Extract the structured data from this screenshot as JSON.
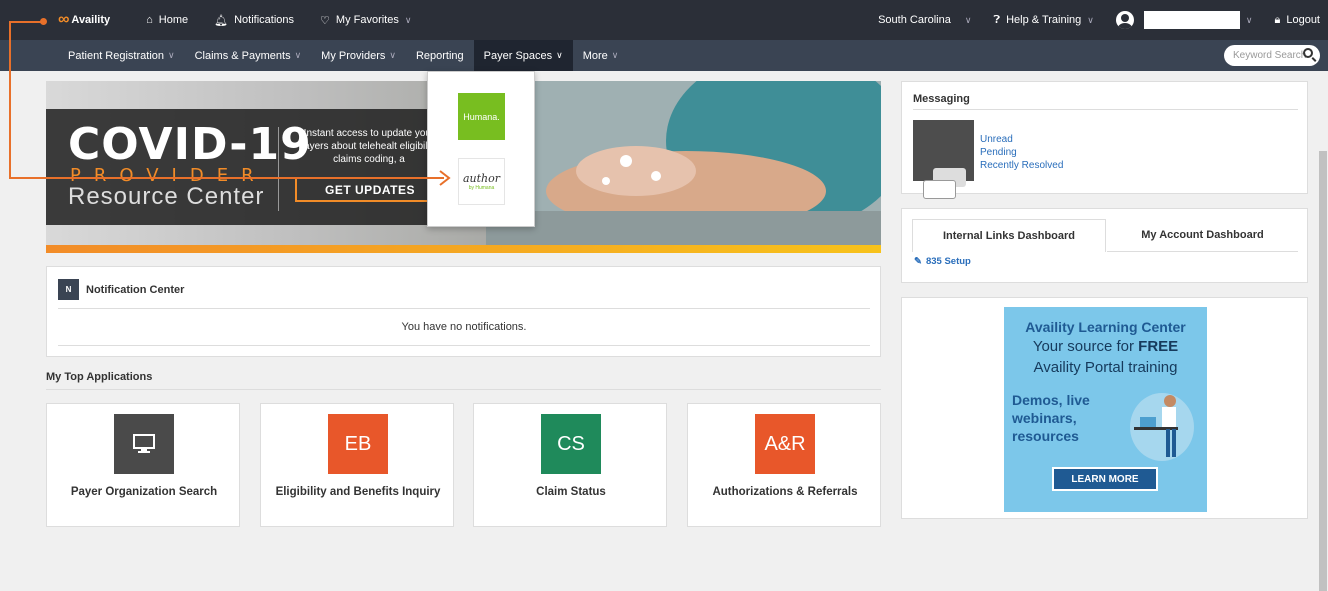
{
  "topbar": {
    "brand": "Availity",
    "home": "Home",
    "notifications": "Notifications",
    "favorites": "My Favorites",
    "region": "South Carolina",
    "help": "Help & Training",
    "logout": "Logout"
  },
  "subnav": {
    "items": [
      "Patient Registration",
      "Claims & Payments",
      "My Providers",
      "Reporting",
      "Payer Spaces",
      "More"
    ],
    "search_placeholder": "Keyword Search"
  },
  "dropdown": {
    "humana": "Humana.",
    "author": "author",
    "author_by": "by Humana"
  },
  "banner": {
    "title": "COVID-19",
    "provider": "PROVIDER",
    "resource": "Resource Center",
    "desc": "Instant access to update your payers about telehealt eligibility, claims coding, a",
    "button": "GET UPDATES"
  },
  "notifications": {
    "badge": "N",
    "title": "Notification Center",
    "empty": "You have no notifications."
  },
  "top_apps": {
    "title": "My Top Applications",
    "apps": [
      {
        "icon": "",
        "label": "Payer Organization Search",
        "color": "#4a4a4a"
      },
      {
        "icon": "EB",
        "label": "Eligibility and Benefits Inquiry",
        "color": "#e8572a"
      },
      {
        "icon": "CS",
        "label": "Claim Status",
        "color": "#1f8a5b"
      },
      {
        "icon": "A&R",
        "label": "Authorizations & Referrals",
        "color": "#e8572a"
      }
    ]
  },
  "messaging": {
    "title": "Messaging",
    "links": [
      "Unread",
      "Pending",
      "Recently Resolved"
    ]
  },
  "dashboard": {
    "tab_active": "Internal Links Dashboard",
    "tab_inactive": "My Account Dashboard",
    "link": "835 Setup"
  },
  "learning": {
    "title": "Availity Learning Center",
    "sub1_a": "Your source for ",
    "sub1_b": "FREE",
    "sub2": "Availity Portal training",
    "demo": "Demos, live webinars, resources",
    "button": "LEARN MORE"
  },
  "colors": {
    "accent": "#e8702a",
    "topbar": "#2b2f38",
    "subnav": "#3a4453",
    "link": "#2a6ebb"
  }
}
